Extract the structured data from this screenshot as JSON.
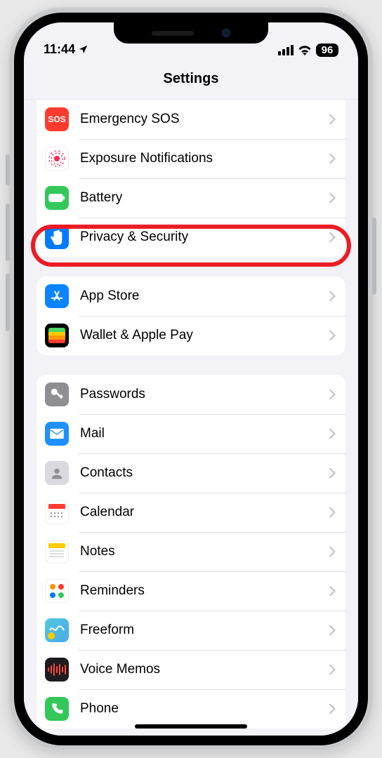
{
  "statusbar": {
    "time": "11:44",
    "battery": "96"
  },
  "header": {
    "title": "Settings"
  },
  "groups": [
    {
      "rows": [
        {
          "label": "Emergency SOS"
        },
        {
          "label": "Exposure Notifications"
        },
        {
          "label": "Battery"
        },
        {
          "label": "Privacy & Security"
        }
      ]
    },
    {
      "rows": [
        {
          "label": "App Store"
        },
        {
          "label": "Wallet & Apple Pay"
        }
      ]
    },
    {
      "rows": [
        {
          "label": "Passwords"
        },
        {
          "label": "Mail"
        },
        {
          "label": "Contacts"
        },
        {
          "label": "Calendar"
        },
        {
          "label": "Notes"
        },
        {
          "label": "Reminders"
        },
        {
          "label": "Freeform"
        },
        {
          "label": "Voice Memos"
        },
        {
          "label": "Phone"
        }
      ]
    }
  ],
  "highlighted_row": "Privacy & Security"
}
